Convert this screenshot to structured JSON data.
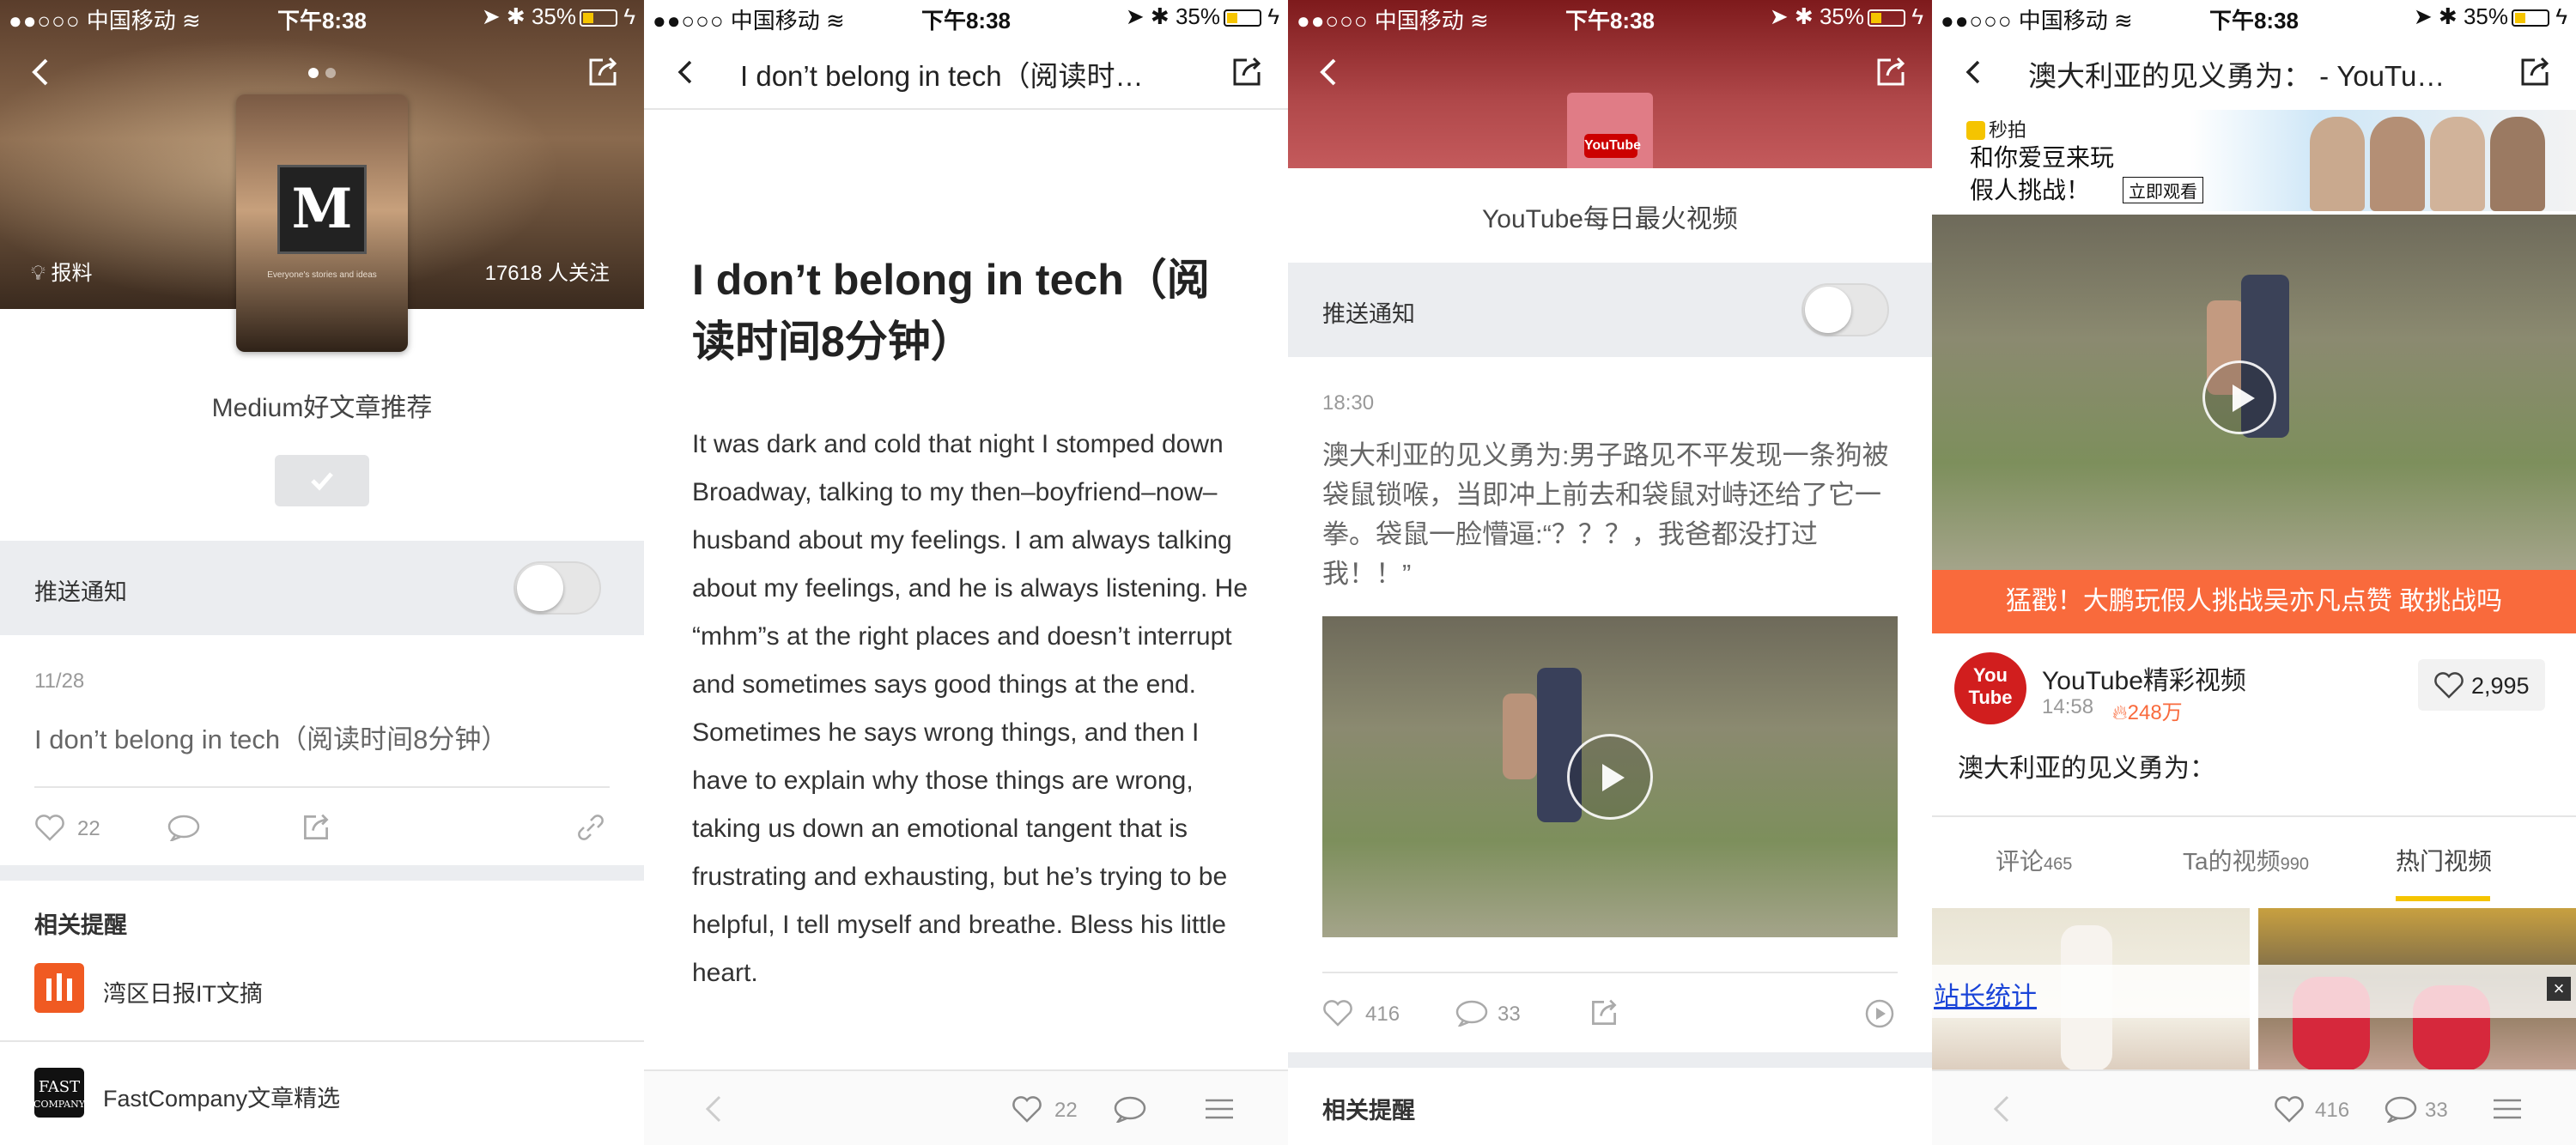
{
  "status": {
    "carrier": "中国移动",
    "time": "下午8:38",
    "battery": "35%"
  },
  "screen1": {
    "cover_letter": "M",
    "cover_tagline": "Everyone's stories and ideas",
    "baoliao": "报料",
    "followers": "17618 人关注",
    "title": "Medium好文章推荐",
    "push_label": "推送通知",
    "date": "11/28",
    "article": "I don’t belong in tech（阅读时间8分钟）",
    "likes": "22",
    "related_title": "相关提醒",
    "related": [
      {
        "name": "湾区日报IT文摘",
        "icon": "wanqu-icon",
        "color": "#f05a22"
      },
      {
        "name": "FastCompany文章精选",
        "icon": "fastcompany-icon",
        "color": "#111111"
      }
    ]
  },
  "screen2": {
    "nav_title": "I don’t belong in tech（阅读时…",
    "heading": "I don’t belong in tech（阅读时间8分钟）",
    "body": "It was dark and cold that night I stomped down Broadway, talking to my then–boyfriend–now–husband about my feelings. I am always talking about my feelings, and he is always listening. He “mhm”s at the right places and doesn’t interrupt and sometimes says good things at the end. Sometimes he says wrong things, and then I have to explain why those things are wrong, taking us down an emotional tangent that is frustrating and exhausting, but he’s trying to be helpful, I tell myself and breathe. Bless his little heart.",
    "likes": "22"
  },
  "screen3": {
    "thumb_label": "YouTube",
    "title": "YouTube每日最火视频",
    "push_label": "推送通知",
    "time": "18:30",
    "text": "澳大利亚的见义勇为:男子路见不平发现一条狗被袋鼠锁喉，当即冲上前去和袋鼠对峙还给了它一拳。袋鼠一脸懵逼:“？？？，我爸都没打过我！！”",
    "likes": "416",
    "comments": "33",
    "related_title": "相关提醒"
  },
  "screen4": {
    "nav_title": "澳大利亚的见义勇为： - YouTu…",
    "ad_brand": "秒拍",
    "ad_line1": "和你爱豆来玩",
    "ad_line2": "假人挑战！",
    "ad_button": "立即观看",
    "orange_banner": "猛戳！大鹏玩假人挑战吴亦凡点赞 敢挑战吗",
    "avatar_text": "You Tube",
    "channel": "YouTube精彩视频",
    "post_time": "14:58",
    "hot_count": "248万",
    "like_count": "2,995",
    "description": "澳大利亚的见义勇为：",
    "tabs": [
      {
        "label": "评论",
        "count": "465"
      },
      {
        "label": "Ta的视频",
        "count": "990"
      },
      {
        "label": "热门视频",
        "count": ""
      }
    ],
    "stat_link": "站长统计",
    "likes": "416",
    "comments": "33"
  },
  "colors": {
    "accent_yellow": "#f5c400",
    "orange": "#f96a3c",
    "link_blue": "#1a44d8",
    "youtube_red": "#d11e1e"
  }
}
